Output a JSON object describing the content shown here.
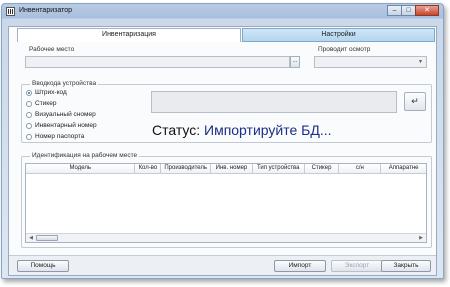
{
  "window": {
    "title": "Инвентаризатор"
  },
  "tabs": [
    {
      "label": "Инвентаризация"
    },
    {
      "label": "Настройки"
    }
  ],
  "workplace": {
    "label": "Рабочее место",
    "value": "",
    "browse_label": "..."
  },
  "auditor": {
    "label": "Проводит осмотр",
    "value": ""
  },
  "input_group": {
    "title": "Вводкода устройства",
    "options": [
      "Штрих-код",
      "Стикер",
      "Визуальный сномер",
      "Инвентарный номер",
      "Номер паспорта"
    ],
    "selected": "Штрих-код"
  },
  "barcode": {
    "value": ""
  },
  "enter_icon": "return-arrow-icon",
  "status": {
    "caption": "Статус:",
    "value": "Импортируйте БД..."
  },
  "identification": {
    "title": "Идентификация на рабочем месте",
    "columns": [
      "Модель",
      "Кол-во",
      "Производитель",
      "Инв. номер",
      "Тип устройства",
      "Стикер",
      "с/н",
      "Аппаратне"
    ],
    "rows": []
  },
  "buttons": {
    "help": "Помощь",
    "import": "Импорт",
    "export": "Экспорт",
    "close": "Закрыть"
  },
  "colors": {
    "status_value": "#1c2e86",
    "active_tab_inactive_bg": "#b4d6ef"
  }
}
